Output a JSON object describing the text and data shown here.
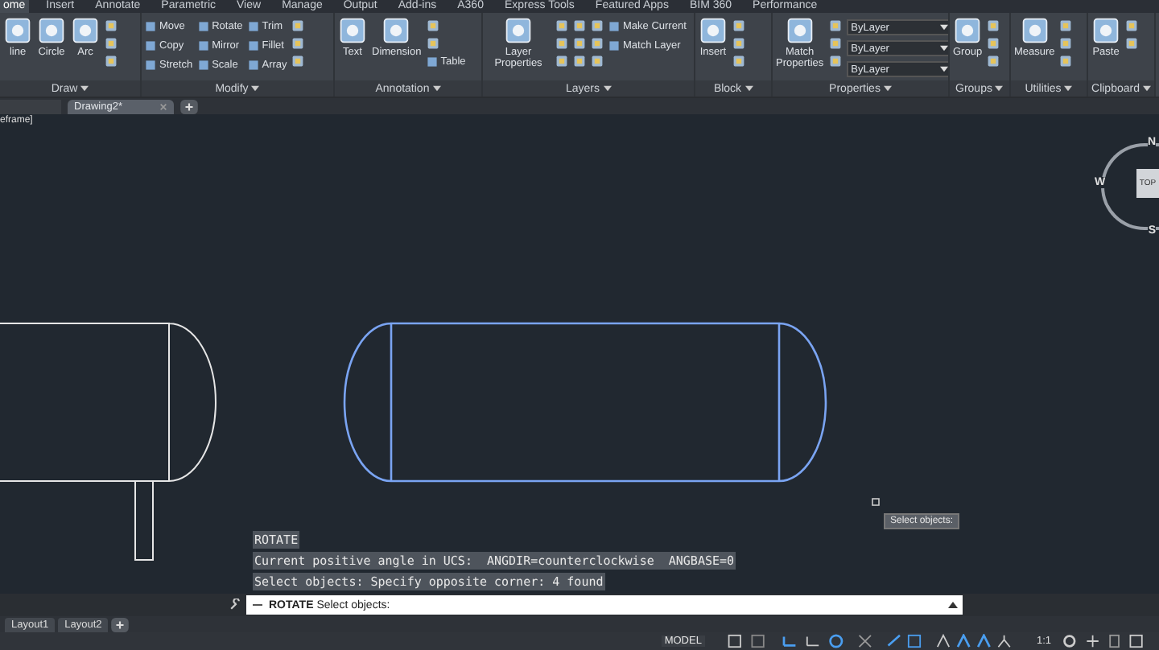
{
  "ribbon_tabs": [
    {
      "label": "ome",
      "selected": true
    },
    {
      "label": "Insert",
      "selected": false
    },
    {
      "label": "Annotate",
      "selected": false
    },
    {
      "label": "Parametric",
      "selected": false
    },
    {
      "label": "View",
      "selected": false
    },
    {
      "label": "Manage",
      "selected": false
    },
    {
      "label": "Output",
      "selected": false
    },
    {
      "label": "Add-ins",
      "selected": false
    },
    {
      "label": "A360",
      "selected": false
    },
    {
      "label": "Express Tools",
      "selected": false
    },
    {
      "label": "Featured Apps",
      "selected": false
    },
    {
      "label": "BIM 360",
      "selected": false
    },
    {
      "label": "Performance",
      "selected": false
    }
  ],
  "panels": [
    {
      "title": "Draw",
      "tools": [
        {
          "kind": "large",
          "label": "line"
        },
        {
          "kind": "large",
          "label": "Circle"
        },
        {
          "kind": "large",
          "label": "Arc"
        },
        {
          "kind": "icon"
        },
        {
          "kind": "icon"
        },
        {
          "kind": "icon"
        }
      ]
    },
    {
      "title": "Modify",
      "tools": [
        {
          "kind": "small",
          "label": "Move"
        },
        {
          "kind": "small",
          "label": "Copy"
        },
        {
          "kind": "small",
          "label": "Stretch"
        },
        {
          "kind": "small",
          "label": "Rotate"
        },
        {
          "kind": "small",
          "label": "Mirror"
        },
        {
          "kind": "small",
          "label": "Scale"
        },
        {
          "kind": "small",
          "label": "Trim"
        },
        {
          "kind": "small",
          "label": "Fillet"
        },
        {
          "kind": "small",
          "label": "Array"
        },
        {
          "kind": "icon"
        },
        {
          "kind": "icon"
        },
        {
          "kind": "icon"
        }
      ]
    },
    {
      "title": "Annotation",
      "tools": [
        {
          "kind": "large",
          "label": "Text"
        },
        {
          "kind": "large",
          "label": "Dimension"
        },
        {
          "kind": "icon"
        },
        {
          "kind": "icon"
        },
        {
          "kind": "small",
          "label": "Table"
        }
      ]
    },
    {
      "title": "Layers",
      "tools": [
        {
          "kind": "large",
          "label": "Layer Properties"
        },
        {
          "kind": "icon"
        },
        {
          "kind": "icon"
        },
        {
          "kind": "icon"
        },
        {
          "kind": "icon"
        },
        {
          "kind": "icon"
        },
        {
          "kind": "icon"
        },
        {
          "kind": "icon"
        },
        {
          "kind": "icon"
        },
        {
          "kind": "icon"
        },
        {
          "kind": "small",
          "label": "Make Current"
        },
        {
          "kind": "small",
          "label": "Match Layer"
        }
      ]
    },
    {
      "title": "Block",
      "tools": [
        {
          "kind": "large",
          "label": "Insert"
        },
        {
          "kind": "icon"
        },
        {
          "kind": "icon"
        },
        {
          "kind": "icon"
        }
      ]
    },
    {
      "title": "Properties",
      "tools": [
        {
          "kind": "large",
          "label": "Match Properties"
        },
        {
          "kind": "icon"
        },
        {
          "kind": "icon"
        },
        {
          "kind": "icon"
        },
        {
          "kind": "combo",
          "label": "ByLayer"
        },
        {
          "kind": "combo",
          "label": "ByLayer"
        },
        {
          "kind": "combo",
          "label": "ByLayer"
        }
      ]
    },
    {
      "title": "Groups",
      "tools": [
        {
          "kind": "large",
          "label": "Group"
        },
        {
          "kind": "icon"
        },
        {
          "kind": "icon"
        },
        {
          "kind": "icon"
        }
      ]
    },
    {
      "title": "Utilities",
      "tools": [
        {
          "kind": "large",
          "label": "Measure"
        },
        {
          "kind": "icon"
        },
        {
          "kind": "icon"
        },
        {
          "kind": "icon"
        }
      ]
    },
    {
      "title": "Clipboard",
      "tools": [
        {
          "kind": "large",
          "label": "Paste"
        },
        {
          "kind": "icon"
        },
        {
          "kind": "icon"
        }
      ]
    }
  ],
  "doc_tabs": [
    {
      "label": "Drawing2*",
      "selected": true
    }
  ],
  "viewport_label": "eframe]",
  "viewcube": {
    "north": "N",
    "west": "W",
    "south": "S",
    "face": "TOP"
  },
  "tooltip": "Select objects:",
  "command_history": [
    "ROTATE",
    "Current positive angle in UCS:  ANGDIR=counterclockwise  ANGBASE=0",
    "Select objects: Specify opposite corner: 4 found"
  ],
  "command_line": "**ROTATE** Select objects:",
  "layout_tabs": [
    {
      "label": "Layout1",
      "selected": false
    },
    {
      "label": "Layout2",
      "selected": false
    }
  ],
  "status_bar": {
    "space": "MODEL",
    "scale": "1:1"
  }
}
